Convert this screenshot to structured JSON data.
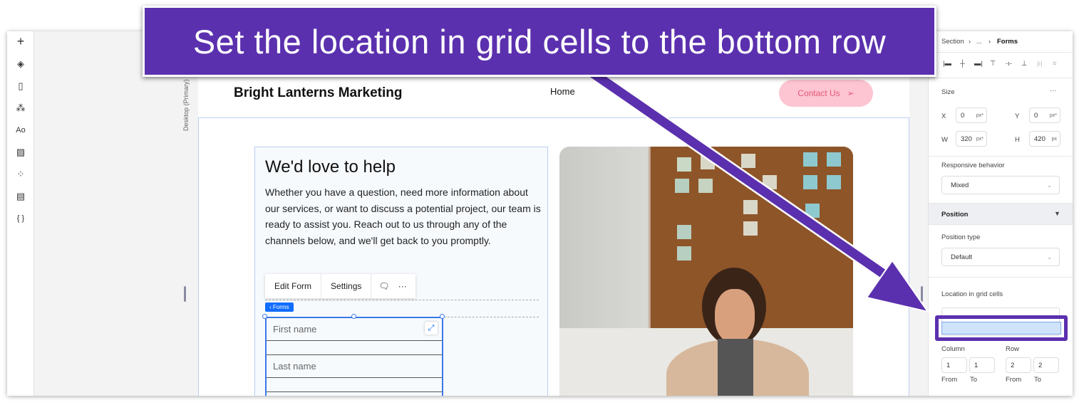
{
  "banner": {
    "text": "Set the location in grid cells to the bottom row",
    "color": "#5b30ae"
  },
  "toolbar": {
    "icons": [
      "plus-icon",
      "layers-icon",
      "page-icon",
      "connections-icon",
      "typography-icon",
      "image-icon",
      "apps-icon",
      "table-icon",
      "code-icon"
    ]
  },
  "canvas": {
    "device_label": "Desktop (Primary)"
  },
  "site": {
    "brand": "Bright Lanterns Marketing",
    "nav_home": "Home",
    "contact_button": "Contact Us",
    "heading": "We'd love to help",
    "paragraph": "Whether you have a question, need more information about our services, or want to discuss a potential project, our team is ready to assist you. Reach out to us through any of the channels below, and we'll get back to you promptly.",
    "context_menu": {
      "edit_form": "Edit Form",
      "settings": "Settings"
    },
    "forms_tag": "‹ Forms",
    "fields": {
      "first_name": "First name",
      "last_name": "Last name"
    },
    "accent": "#116dff",
    "contact_bg": "#fdc5d1"
  },
  "panel": {
    "breadcrumb": {
      "section": "Section",
      "ellipsis": "...",
      "current": "Forms"
    },
    "size": {
      "title": "Size",
      "more": "···",
      "x_label": "X",
      "x": "0",
      "x_unit": "px*",
      "y_label": "Y",
      "y": "0",
      "y_unit": "px*",
      "w_label": "W",
      "w": "320",
      "w_unit": "px*",
      "h_label": "H",
      "h": "420",
      "h_unit": "px"
    },
    "responsive": {
      "label": "Responsive behavior",
      "value": "Mixed"
    },
    "position": {
      "title": "Position",
      "type_label": "Position type",
      "type_value": "Default"
    },
    "grid": {
      "label": "Location in grid cells",
      "column_label": "Column",
      "row_label": "Row",
      "col_from": "1",
      "col_to": "1",
      "row_from": "2",
      "row_to": "2",
      "from": "From",
      "to": "To"
    }
  }
}
